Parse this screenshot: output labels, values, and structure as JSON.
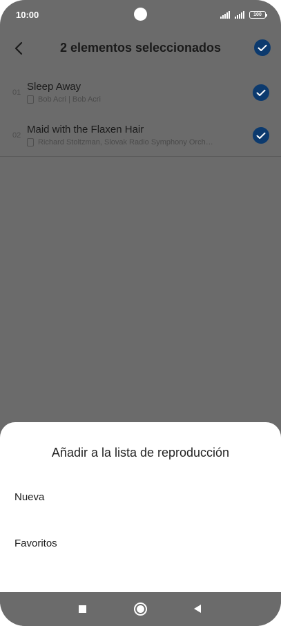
{
  "status_bar": {
    "time": "10:00",
    "battery": "100"
  },
  "header": {
    "title": "2 elementos seleccionados"
  },
  "tracks": [
    {
      "number": "01",
      "title": "Sleep Away",
      "artist": "Bob Acri | Bob Acri",
      "selected": true
    },
    {
      "number": "02",
      "title": "Maid with the Flaxen Hair",
      "artist": "Richard Stoltzman, Slovak Radio Symphony Orch…",
      "selected": true
    }
  ],
  "sheet": {
    "title": "Añadir a la lista de reproducción",
    "options": [
      "Nueva",
      "Favoritos"
    ]
  },
  "colors": {
    "overlay": "#6b6b6b",
    "check_fill": "#0c3a6e",
    "sheet_bg": "#ffffff"
  },
  "icons": {
    "back": "chevron-left-icon",
    "check": "checkmark-icon",
    "device": "phone-device-icon",
    "recents": "square-icon",
    "home": "circle-icon",
    "nav_back": "triangle-back-icon"
  }
}
